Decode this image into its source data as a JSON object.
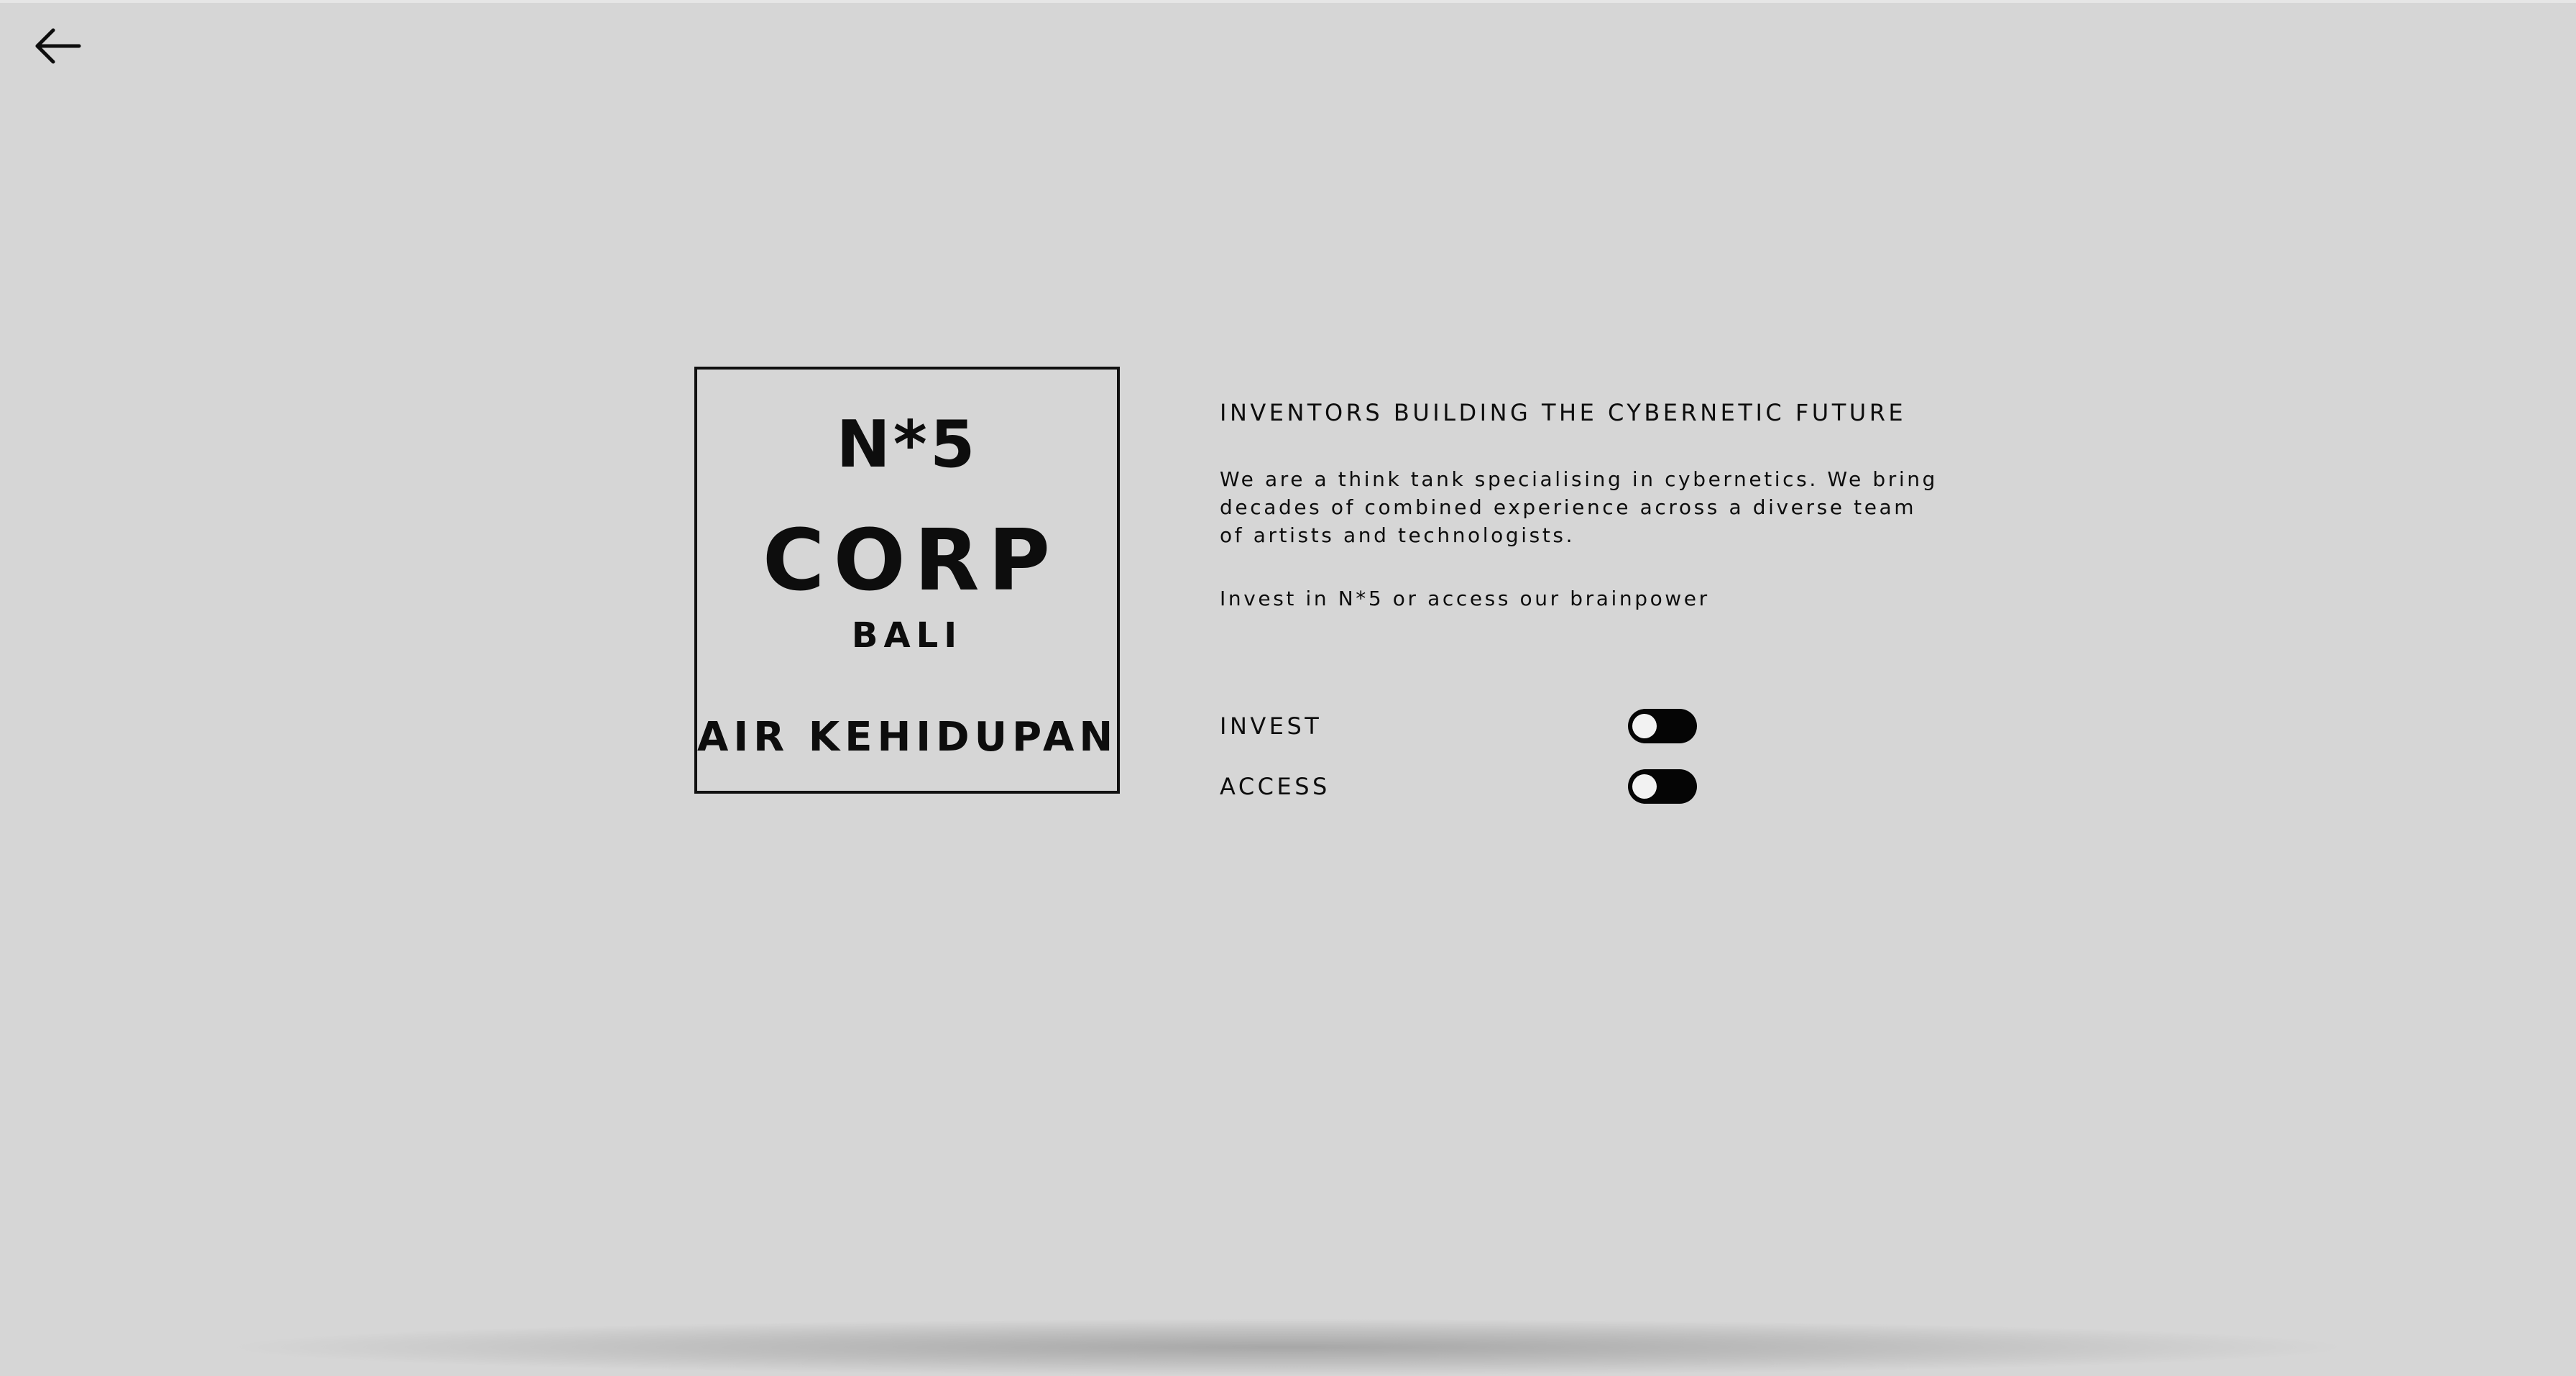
{
  "navigation": {
    "back_icon": "arrow-left-icon"
  },
  "logo": {
    "number": "N*5",
    "name": "CORP",
    "city": "BALI",
    "tagline": "AIR KEHIDUPAN"
  },
  "main": {
    "headline": "INVENTORS BUILDING THE CYBERNETIC FUTURE",
    "description": "We are a think tank specialising in cybernetics. We bring decades of combined experience across a diverse team of artists and technologists.",
    "cta": "Invest in N*5 or access our brainpower"
  },
  "toggles": [
    {
      "label": "INVEST",
      "state": "off"
    },
    {
      "label": "ACCESS",
      "state": "off"
    }
  ],
  "colors": {
    "background": "#d6d6d6",
    "text": "#0d0d0d",
    "toggle_track": "#050505",
    "toggle_knob": "#f2f2f2"
  }
}
